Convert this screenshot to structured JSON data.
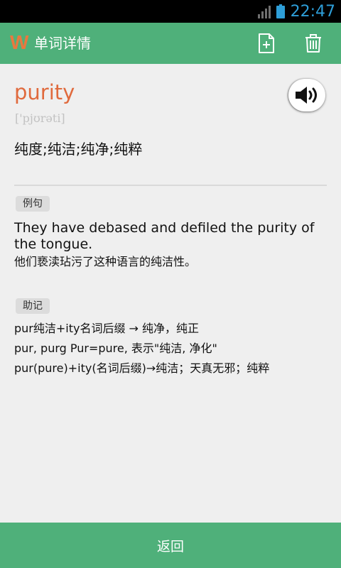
{
  "status_bar": {
    "time": "22:47"
  },
  "app_bar": {
    "logo_text": "W",
    "title": "单词详情",
    "add_icon": "add-file-icon",
    "delete_icon": "trash-icon"
  },
  "word": {
    "text": "purity",
    "phonetic": "['pjʊrəti]",
    "meaning": "纯度;纯洁;纯净;纯粹",
    "speaker_icon": "speaker-icon"
  },
  "example": {
    "tag": "例句",
    "english": "They have debased and defiled the purity of the tongue.",
    "chinese": "他们亵渎玷污了这种语言的纯洁性。"
  },
  "mnemonic": {
    "tag": "助记",
    "lines": [
      "pur纯洁+ity名词后缀 → 纯净，纯正",
      "pur, purg Pur=pure, 表示\"纯洁, 净化\"",
      "pur(pure)+ity(名词后缀)→纯洁；天真无邪；纯粹"
    ]
  },
  "bottom_bar": {
    "back_label": "返回"
  },
  "colors": {
    "accent_green": "#4fb07a",
    "word_orange": "#e06a3d",
    "logo_orange": "#e9783f",
    "status_blue": "#2e9ed8"
  }
}
